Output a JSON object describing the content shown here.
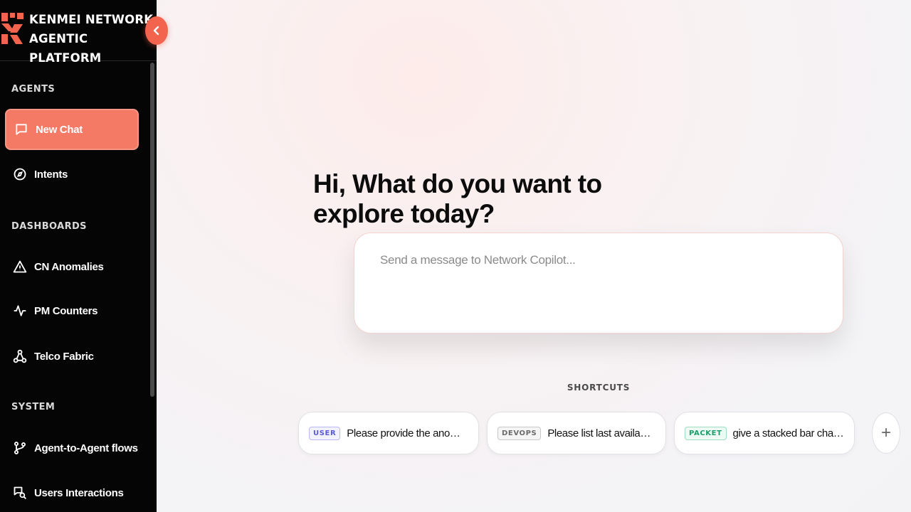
{
  "brand": {
    "line1": "KENMEI NETWORK",
    "line2": "AGENTIC PLATFORM",
    "logo_icon": "kenmei-logo-icon",
    "accent": "#f2644e"
  },
  "sidebar": {
    "collapse_icon": "chevron-left-icon",
    "sections": [
      {
        "label": "AGENTS",
        "items": [
          {
            "label": "New Chat",
            "icon": "chat-bubble-icon",
            "active": true
          },
          {
            "label": "Intents",
            "icon": "compass-icon",
            "active": false
          }
        ]
      },
      {
        "label": "DASHBOARDS",
        "items": [
          {
            "label": "CN Anomalies",
            "icon": "warning-triangle-icon",
            "active": false
          },
          {
            "label": "PM Counters",
            "icon": "activity-pulse-icon",
            "active": false
          },
          {
            "label": "Telco Fabric",
            "icon": "network-nodes-icon",
            "active": false
          }
        ]
      },
      {
        "label": "SYSTEM",
        "items": [
          {
            "label": "Agent-to-Agent flows",
            "icon": "git-branch-icon",
            "active": false
          },
          {
            "label": "Users Interactions",
            "icon": "messages-search-icon",
            "active": false
          }
        ]
      }
    ]
  },
  "main": {
    "greeting": "Hi, What do you want to explore today?",
    "composer": {
      "placeholder": "Send a message to Network Copilot...",
      "value": ""
    },
    "shortcuts": {
      "label": "SHORTCUTS",
      "items": [
        {
          "tag": "USER",
          "text": "Please provide the anomalies r...",
          "tag_color": "#5b5bd6"
        },
        {
          "tag": "DEVOPS",
          "text": "Please list last available ano...",
          "tag_color": "#6b6b6b"
        },
        {
          "tag": "PACKET",
          "text": "give a stacked bar chart in a ...",
          "tag_color": "#1e9e6a"
        }
      ],
      "add_icon": "plus-icon",
      "add_label": "+"
    }
  }
}
